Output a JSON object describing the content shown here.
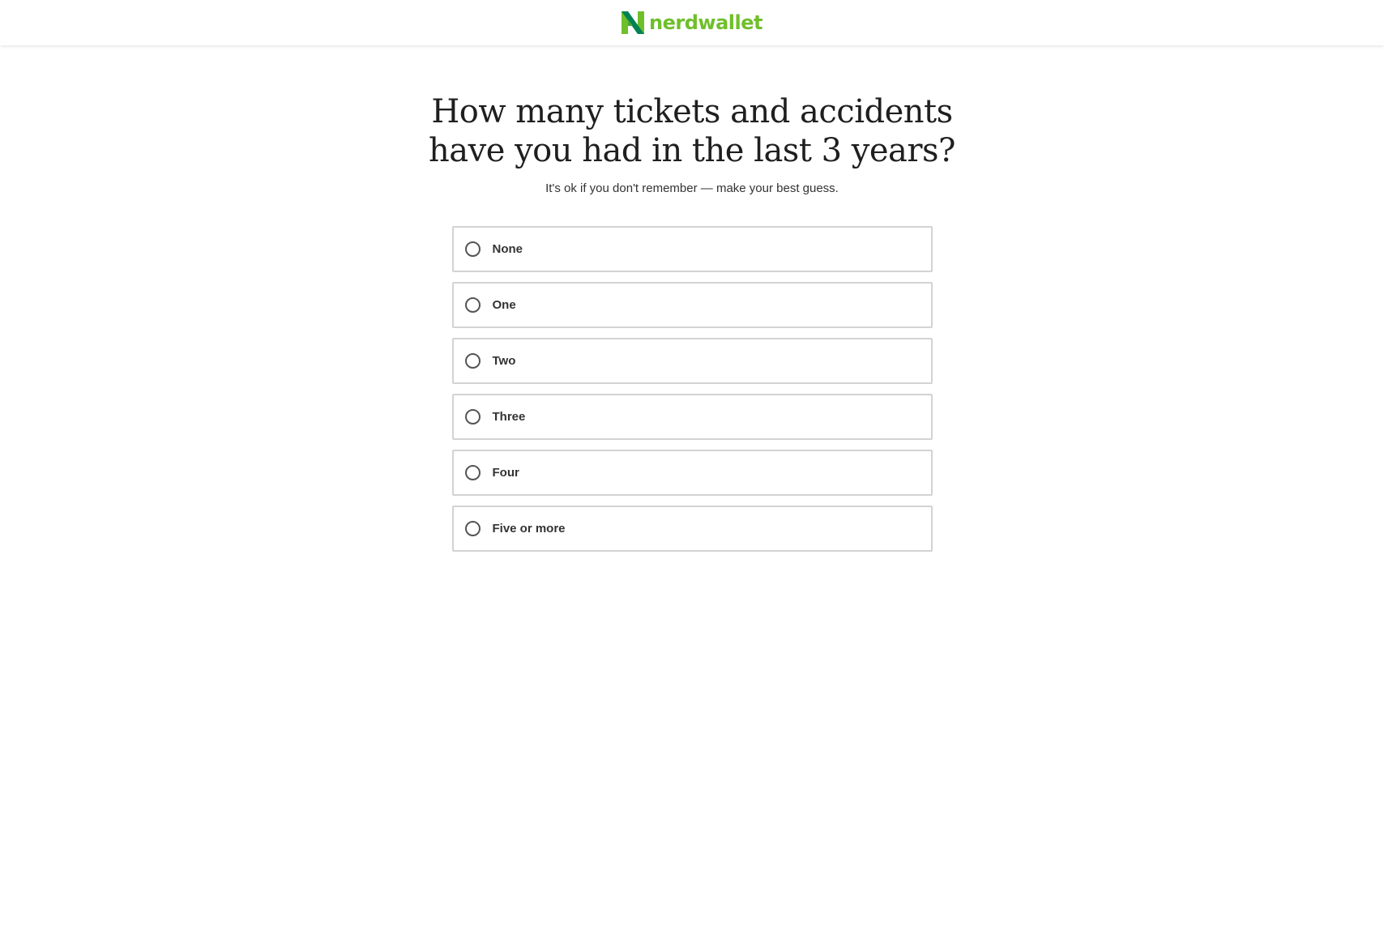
{
  "header": {
    "logo_text": "nerdwallet",
    "logo_icon": "nerdwallet-n-logo-icon",
    "brand_color": "#6fbf2b",
    "brand_color_dark": "#008254"
  },
  "question": {
    "title": "How many tickets and accidents have you had in the last 3 years?",
    "subtitle": "It's ok if you don't remember — make your best guess."
  },
  "options": [
    {
      "label": "None",
      "selected": false
    },
    {
      "label": "One",
      "selected": false
    },
    {
      "label": "Two",
      "selected": false
    },
    {
      "label": "Three",
      "selected": false
    },
    {
      "label": "Four",
      "selected": false
    },
    {
      "label": "Five or more",
      "selected": false
    }
  ]
}
